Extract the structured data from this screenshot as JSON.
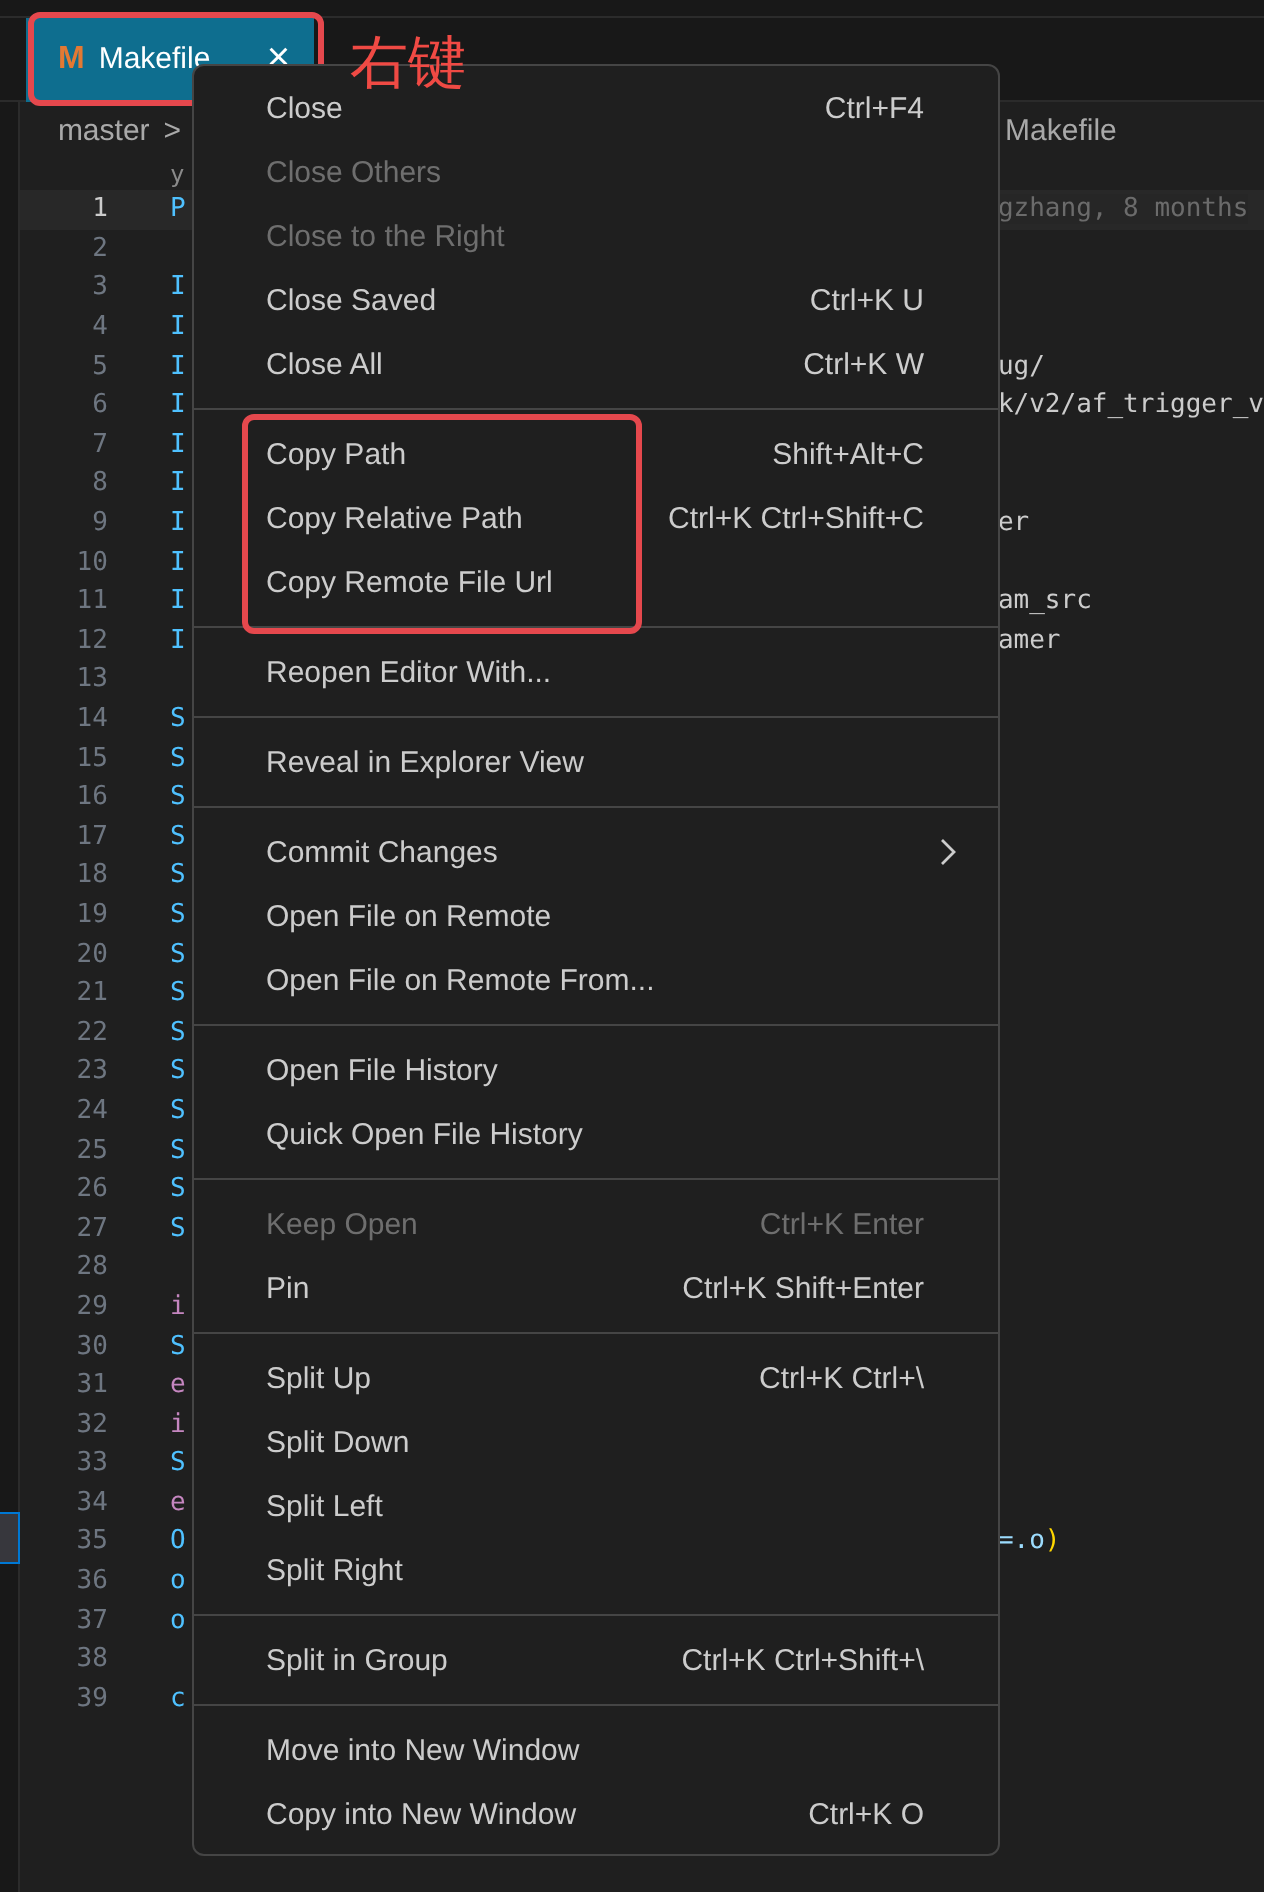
{
  "tab": {
    "icon": "M",
    "label": "Makefile",
    "close": "×",
    "selected": true
  },
  "annotation": {
    "text": "右键"
  },
  "breadcrumb": {
    "root": "master",
    "separator": ">",
    "file": "Makefile"
  },
  "codelens": {
    "head": "y"
  },
  "lines": [
    {
      "number": "1",
      "head": {
        "text": "P",
        "kind": "ident"
      },
      "tail": [
        {
          "text": "gzhang, 8 months",
          "kind": "blame"
        }
      ],
      "current": true
    },
    {
      "number": "2",
      "current": false
    },
    {
      "number": "3",
      "head": {
        "text": "I",
        "kind": "ident"
      },
      "current": false
    },
    {
      "number": "4",
      "head": {
        "text": "I",
        "kind": "ident"
      },
      "current": false
    },
    {
      "number": "5",
      "head": {
        "text": "I",
        "kind": "ident"
      },
      "tail": [
        {
          "text": "ug/",
          "kind": "text"
        }
      ],
      "current": false
    },
    {
      "number": "6",
      "head": {
        "text": "I",
        "kind": "ident"
      },
      "tail": [
        {
          "text": "k/v2/af_trigger_v",
          "kind": "text"
        }
      ],
      "current": false
    },
    {
      "number": "7",
      "head": {
        "text": "I",
        "kind": "ident"
      },
      "current": false
    },
    {
      "number": "8",
      "head": {
        "text": "I",
        "kind": "ident"
      },
      "current": false
    },
    {
      "number": "9",
      "head": {
        "text": "I",
        "kind": "ident"
      },
      "tail": [
        {
          "text": "er",
          "kind": "text"
        }
      ],
      "current": false
    },
    {
      "number": "10",
      "head": {
        "text": "I",
        "kind": "ident"
      },
      "current": false
    },
    {
      "number": "11",
      "head": {
        "text": "I",
        "kind": "ident"
      },
      "tail": [
        {
          "text": "am_src",
          "kind": "text"
        }
      ],
      "current": false
    },
    {
      "number": "12",
      "head": {
        "text": "I",
        "kind": "ident"
      },
      "tail": [
        {
          "text": "amer",
          "kind": "text"
        }
      ],
      "current": false
    },
    {
      "number": "13",
      "current": false
    },
    {
      "number": "14",
      "head": {
        "text": "S",
        "kind": "ident"
      },
      "current": false
    },
    {
      "number": "15",
      "head": {
        "text": "S",
        "kind": "ident"
      },
      "current": false
    },
    {
      "number": "16",
      "head": {
        "text": "S",
        "kind": "ident"
      },
      "current": false
    },
    {
      "number": "17",
      "head": {
        "text": "S",
        "kind": "ident"
      },
      "current": false
    },
    {
      "number": "18",
      "head": {
        "text": "S",
        "kind": "ident"
      },
      "current": false
    },
    {
      "number": "19",
      "head": {
        "text": "S",
        "kind": "ident"
      },
      "current": false
    },
    {
      "number": "20",
      "head": {
        "text": "S",
        "kind": "ident"
      },
      "current": false
    },
    {
      "number": "21",
      "head": {
        "text": "S",
        "kind": "ident"
      },
      "current": false
    },
    {
      "number": "22",
      "head": {
        "text": "S",
        "kind": "ident"
      },
      "current": false
    },
    {
      "number": "23",
      "head": {
        "text": "S",
        "kind": "ident"
      },
      "current": false
    },
    {
      "number": "24",
      "head": {
        "text": "S",
        "kind": "ident"
      },
      "current": false
    },
    {
      "number": "25",
      "head": {
        "text": "S",
        "kind": "ident"
      },
      "current": false
    },
    {
      "number": "26",
      "head": {
        "text": "S",
        "kind": "ident"
      },
      "current": false
    },
    {
      "number": "27",
      "head": {
        "text": "S",
        "kind": "ident"
      },
      "current": false
    },
    {
      "number": "28",
      "current": false
    },
    {
      "number": "29",
      "head": {
        "text": "i",
        "kind": "keyword"
      },
      "current": false
    },
    {
      "number": "30",
      "head": {
        "text": "S",
        "kind": "ident"
      },
      "current": false
    },
    {
      "number": "31",
      "head": {
        "text": "e",
        "kind": "keyword"
      },
      "current": false
    },
    {
      "number": "32",
      "head": {
        "text": "i",
        "kind": "keyword"
      },
      "current": false
    },
    {
      "number": "33",
      "head": {
        "text": "S",
        "kind": "ident"
      },
      "current": false
    },
    {
      "number": "34",
      "head": {
        "text": "e",
        "kind": "keyword"
      },
      "current": false
    },
    {
      "number": "35",
      "head": {
        "text": "O",
        "kind": "ident"
      },
      "tail": [
        {
          "text": "=.o",
          "kind": "ident"
        },
        {
          "text": ")",
          "kind": "bracket"
        }
      ],
      "current": false
    },
    {
      "number": "36",
      "head": {
        "text": "o",
        "kind": "ident"
      },
      "current": false
    },
    {
      "number": "37",
      "head": {
        "text": "o",
        "kind": "ident"
      },
      "current": false
    },
    {
      "number": "38",
      "current": false
    },
    {
      "number": "39",
      "head": {
        "text": "c",
        "kind": "ident"
      },
      "current": false
    }
  ],
  "menu": {
    "groups": [
      {
        "annotated": false,
        "items": [
          {
            "label": "Close",
            "shortcut": "Ctrl+F4",
            "disabled": false,
            "submenu": false
          },
          {
            "label": "Close Others",
            "disabled": true,
            "submenu": false
          },
          {
            "label": "Close to the Right",
            "disabled": true,
            "submenu": false
          },
          {
            "label": "Close Saved",
            "shortcut": "Ctrl+K U",
            "disabled": false,
            "submenu": false
          },
          {
            "label": "Close All",
            "shortcut": "Ctrl+K W",
            "disabled": false,
            "submenu": false
          }
        ]
      },
      {
        "annotated": true,
        "items": [
          {
            "label": "Copy Path",
            "shortcut": "Shift+Alt+C",
            "disabled": false,
            "submenu": false
          },
          {
            "label": "Copy Relative Path",
            "shortcut": "Ctrl+K Ctrl+Shift+C",
            "disabled": false,
            "submenu": false
          },
          {
            "label": "Copy Remote File Url",
            "disabled": false,
            "submenu": false
          }
        ]
      },
      {
        "annotated": false,
        "items": [
          {
            "label": "Reopen Editor With...",
            "disabled": false,
            "submenu": false
          }
        ]
      },
      {
        "annotated": false,
        "items": [
          {
            "label": "Reveal in Explorer View",
            "disabled": false,
            "submenu": false
          }
        ]
      },
      {
        "annotated": false,
        "items": [
          {
            "label": "Commit Changes",
            "disabled": false,
            "submenu": true
          },
          {
            "label": "Open File on Remote",
            "disabled": false,
            "submenu": false
          },
          {
            "label": "Open File on Remote From...",
            "disabled": false,
            "submenu": false
          }
        ]
      },
      {
        "annotated": false,
        "items": [
          {
            "label": "Open File History",
            "disabled": false,
            "submenu": false
          },
          {
            "label": "Quick Open File History",
            "disabled": false,
            "submenu": false
          }
        ]
      },
      {
        "annotated": false,
        "items": [
          {
            "label": "Keep Open",
            "shortcut": "Ctrl+K Enter",
            "disabled": true,
            "submenu": false
          },
          {
            "label": "Pin",
            "shortcut": "Ctrl+K Shift+Enter",
            "disabled": false,
            "submenu": false
          }
        ]
      },
      {
        "annotated": false,
        "items": [
          {
            "label": "Split Up",
            "shortcut": "Ctrl+K Ctrl+\\",
            "disabled": false,
            "submenu": false
          },
          {
            "label": "Split Down",
            "disabled": false,
            "submenu": false
          },
          {
            "label": "Split Left",
            "disabled": false,
            "submenu": false
          },
          {
            "label": "Split Right",
            "disabled": false,
            "submenu": false
          }
        ]
      },
      {
        "annotated": false,
        "items": [
          {
            "label": "Split in Group",
            "shortcut": "Ctrl+K Ctrl+Shift+\\",
            "disabled": false,
            "submenu": false
          }
        ]
      },
      {
        "annotated": false,
        "items": [
          {
            "label": "Move into New Window",
            "disabled": false,
            "submenu": false
          },
          {
            "label": "Copy into New Window",
            "shortcut": "Ctrl+K O",
            "disabled": false,
            "submenu": false
          }
        ]
      }
    ]
  }
}
